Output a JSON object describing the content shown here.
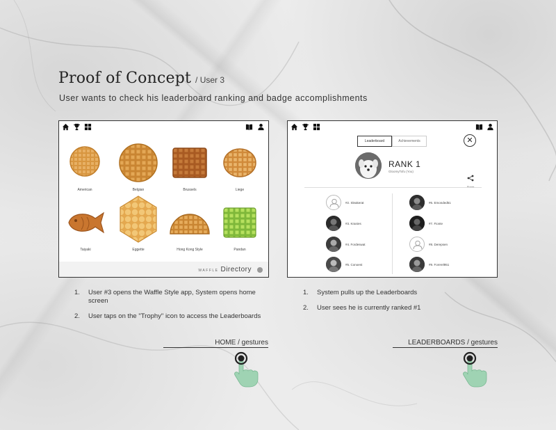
{
  "title": "Proof of Concept",
  "title_suffix": "/ User 3",
  "subtitle": "User wants to check his leaderboard ranking and badge accomplishments",
  "home_screen": {
    "icons_left": [
      "home-icon",
      "trophy-icon",
      "grid-icon"
    ],
    "icons_right": [
      "book-icon",
      "person-icon"
    ],
    "waffles": [
      {
        "label": "American"
      },
      {
        "label": "Belgian"
      },
      {
        "label": "Brussels"
      },
      {
        "label": "Liege"
      },
      {
        "label": "Taiyaki"
      },
      {
        "label": "Eggette"
      },
      {
        "label": "Hong Kong Style"
      },
      {
        "label": "Pandan"
      }
    ],
    "footer_small": "WAFFLE",
    "footer_big": "Directory"
  },
  "leaderboard_screen": {
    "tabs": [
      "Leaderboard",
      "Achievements"
    ],
    "active_tab": "Leaderboard",
    "rank": "RANK 1",
    "username": "GloomyTofu (You)",
    "share_label": "Share",
    "left_entries": [
      {
        "name": "#2. Sleakerat",
        "placeholder": true
      },
      {
        "name": "#3. Kranies",
        "placeholder": false
      },
      {
        "name": "#4. Fordeswat",
        "placeholder": false
      },
      {
        "name": "#5. Conoest",
        "placeholder": false
      }
    ],
    "right_entries": [
      {
        "name": "#6. Emonded51",
        "placeholder": false
      },
      {
        "name": "#7. Fionte",
        "placeholder": false
      },
      {
        "name": "#8. Derepsen",
        "placeholder": true
      },
      {
        "name": "#9. Forerel951",
        "placeholder": false
      }
    ]
  },
  "left_steps": [
    {
      "num": "1.",
      "text": "User #3 opens the Waffle Style app, System opens home screen"
    },
    {
      "num": "2.",
      "text": "User taps on the \"Trophy\" icon to access the Leaderboards"
    }
  ],
  "right_steps": [
    {
      "num": "1.",
      "text": "System pulls up the Leaderboards"
    },
    {
      "num": "2.",
      "text": "User sees he is currently ranked #1"
    }
  ],
  "left_gesture_label": "HOME / gestures",
  "right_gesture_label": "LEADERBOARDS / gestures",
  "colors": {
    "hand": "#9fd3b3",
    "waffle_gold": "#d99a45",
    "pandan": "#9ed24a"
  }
}
